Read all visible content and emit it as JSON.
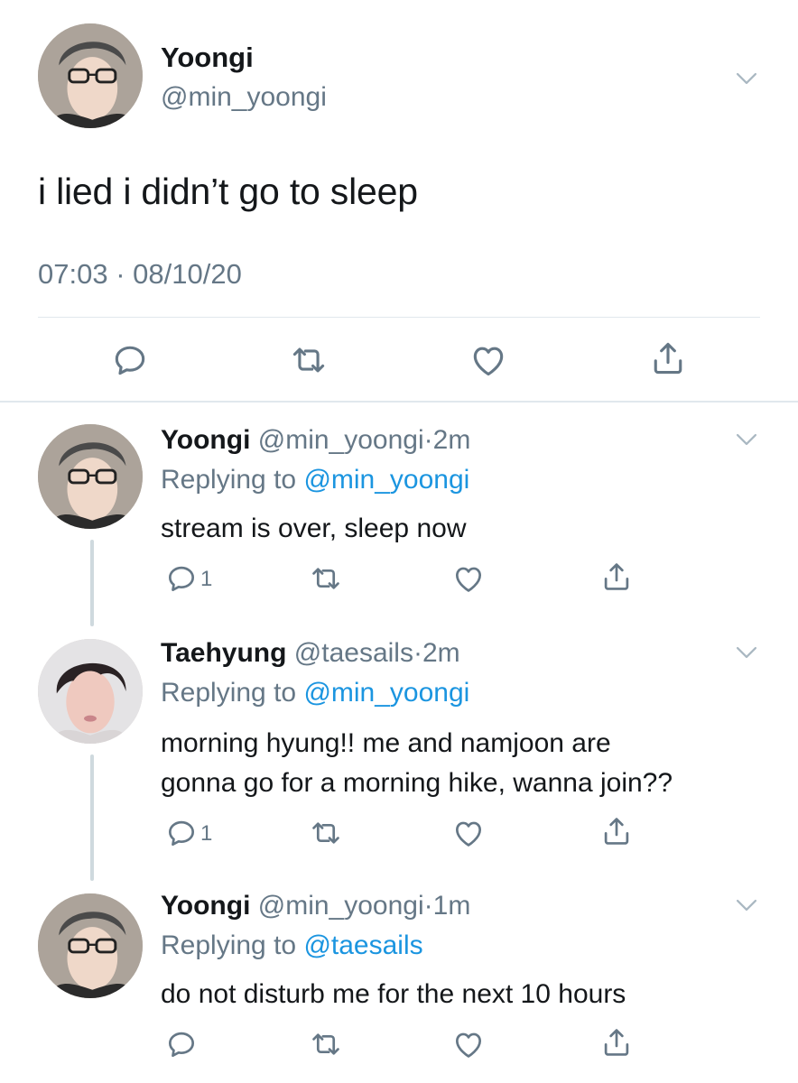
{
  "main_tweet": {
    "display_name": "Yoongi",
    "handle": "@min_yoongi",
    "text": "i lied i didn’t go to sleep",
    "time": "07:03",
    "separator": "·",
    "date": "08/10/20"
  },
  "replies": [
    {
      "display_name": "Yoongi",
      "handle": "@min_yoongi",
      "dot": "·",
      "age": "2m",
      "replying_prefix": "Replying to",
      "replying_to": "@min_yoongi",
      "text_lines": [
        "stream is over, sleep now"
      ],
      "reply_count": "1"
    },
    {
      "display_name": "Taehyung",
      "handle": "@taesails",
      "dot": "·",
      "age": "2m",
      "replying_prefix": "Replying to",
      "replying_to": "@min_yoongi",
      "text_lines": [
        "morning hyung!! me and namjoon are",
        "gonna go for a morning hike, wanna join??"
      ],
      "reply_count": "1"
    },
    {
      "display_name": "Yoongi",
      "handle": "@min_yoongi",
      "dot": "·",
      "age": "1m",
      "replying_prefix": "Replying to",
      "replying_to": "@taesails",
      "text_lines": [
        "do not disturb me for the next 10 hours"
      ],
      "reply_count": ""
    }
  ],
  "icons": {
    "reply": "reply-icon",
    "retweet": "retweet-icon",
    "like": "heart-icon",
    "share": "share-icon",
    "menu": "chevron-down-icon"
  },
  "colors": {
    "text": "#14171a",
    "muted": "#657786",
    "link": "#1b95e0",
    "divider": "#e1e8ed"
  }
}
